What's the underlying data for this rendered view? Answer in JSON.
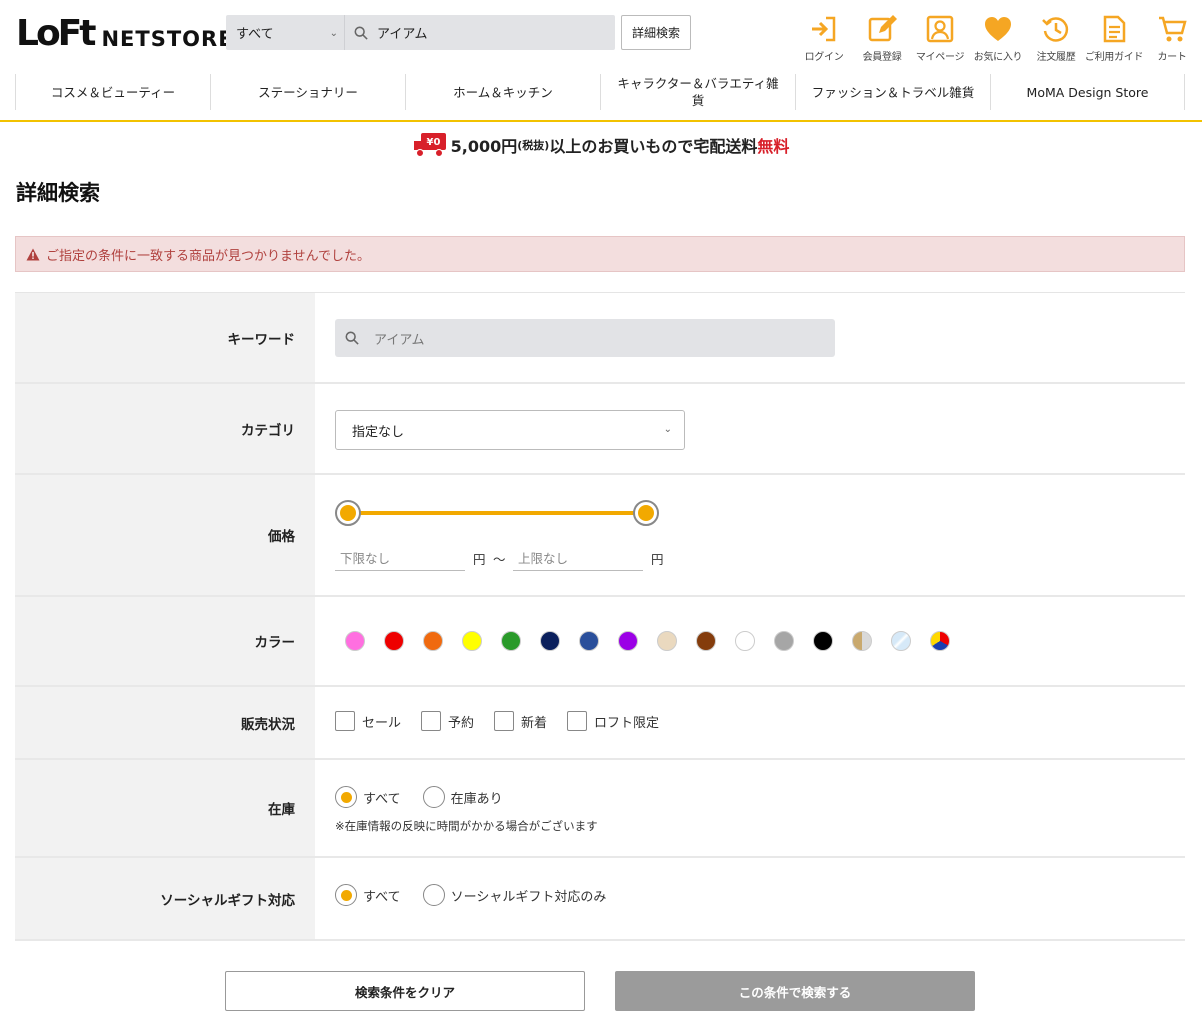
{
  "header": {
    "logo_mark": "LoFt",
    "logo_text": "NETSTORE",
    "search": {
      "scope": "すべて",
      "value": "アイアム"
    },
    "advanced_search_label": "詳細検索",
    "icons": [
      {
        "label": "ログイン",
        "icon": "login-icon"
      },
      {
        "label": "会員登録",
        "icon": "register-icon"
      },
      {
        "label": "マイページ",
        "icon": "mypage-icon"
      },
      {
        "label": "お気に入り",
        "icon": "heart-icon"
      },
      {
        "label": "注文履歴",
        "icon": "history-icon"
      },
      {
        "label": "ご利用ガイド",
        "icon": "guide-icon"
      },
      {
        "label": "カート",
        "icon": "cart-icon"
      }
    ],
    "nav": [
      "コスメ＆ビューティー",
      "ステーショナリー",
      "ホーム＆キッチン",
      "キャラクター＆バラエティ雑貨",
      "ファッション＆トラベル雑貨",
      "MoMA Design Store"
    ]
  },
  "promo": {
    "amount": "5,000円",
    "tax": "(税抜)",
    "text": "以上のお買いもので宅配送料",
    "free": "無料",
    "badge": "¥0"
  },
  "page_title": "詳細検索",
  "alert": "ご指定の条件に一致する商品が見つかりませんでした。",
  "form": {
    "keyword": {
      "label": "キーワード",
      "placeholder": "アイアム"
    },
    "category": {
      "label": "カテゴリ",
      "value": "指定なし"
    },
    "price": {
      "label": "価格",
      "min_placeholder": "下限なし",
      "max_placeholder": "上限なし",
      "unit": "円",
      "separator": "～"
    },
    "color": {
      "label": "カラー",
      "swatches": [
        {
          "name": "pink",
          "color": "#ff6fe0"
        },
        {
          "name": "red",
          "color": "#ee0000"
        },
        {
          "name": "orange",
          "color": "#f06a0f"
        },
        {
          "name": "yellow",
          "color": "#ffff00"
        },
        {
          "name": "green",
          "color": "#2a9a2a"
        },
        {
          "name": "navy",
          "color": "#0a1f5c"
        },
        {
          "name": "blue",
          "color": "#2a4f9b"
        },
        {
          "name": "purple",
          "color": "#9b00e6"
        },
        {
          "name": "beige",
          "color": "#ead9bf"
        },
        {
          "name": "brown",
          "color": "#843c0c"
        },
        {
          "name": "white",
          "color": "#ffffff"
        },
        {
          "name": "gray",
          "color": "#a6a6a6"
        },
        {
          "name": "black",
          "color": "#000000"
        },
        {
          "name": "gold",
          "color": "linear-gradient(90deg,#c9a96e 50%,#d9d9d9 50%)"
        },
        {
          "name": "clear",
          "color": "linear-gradient(135deg,#d6e9f8 40%,#ffffff 50%,#d6e9f8 60%)"
        },
        {
          "name": "multi",
          "color": "conic-gradient(#e00 0 33%,#1a3fb0 0 66%,#ffd800 0 100%)"
        }
      ]
    },
    "sales_status": {
      "label": "販売状況",
      "options": [
        "セール",
        "予約",
        "新着",
        "ロフト限定"
      ]
    },
    "stock": {
      "label": "在庫",
      "options": [
        "すべて",
        "在庫あり"
      ],
      "selected": 0,
      "note": "※在庫情報の反映に時間がかかる場合がございます"
    },
    "social_gift": {
      "label": "ソーシャルギフト対応",
      "options": [
        "すべて",
        "ソーシャルギフト対応のみ"
      ],
      "selected": 0
    }
  },
  "buttons": {
    "clear": "検索条件をクリア",
    "search": "この条件で検索する"
  },
  "colors": {
    "accent": "#f2a900",
    "header_border": "#f2c200",
    "icon": "#f5a623"
  }
}
